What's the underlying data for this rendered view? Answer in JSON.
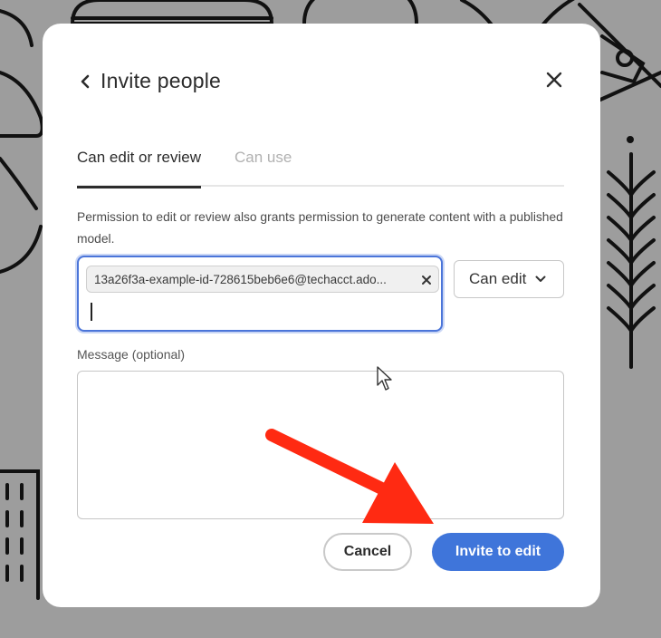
{
  "dialog": {
    "title": "Invite people",
    "back_icon": "chevron-left-icon",
    "close_icon": "close-icon",
    "tabs": [
      {
        "label": "Can edit or review",
        "active": true
      },
      {
        "label": "Can use",
        "active": false
      }
    ],
    "description": "Permission to edit or review also grants permission to generate content with a published model.",
    "invite": {
      "chip_value": "13a26f3a-example-id-728615beb6e6@techacct.ado...",
      "input_value": ""
    },
    "permission": {
      "selected": "Can edit",
      "chevron_icon": "chevron-down-icon"
    },
    "message": {
      "label": "Message (optional)",
      "value": ""
    },
    "buttons": {
      "cancel": "Cancel",
      "invite": "Invite to edit"
    }
  },
  "colors": {
    "primary": "#3f75da",
    "annotation_arrow": "#ff2a12",
    "backdrop": "#9d9d9d"
  }
}
